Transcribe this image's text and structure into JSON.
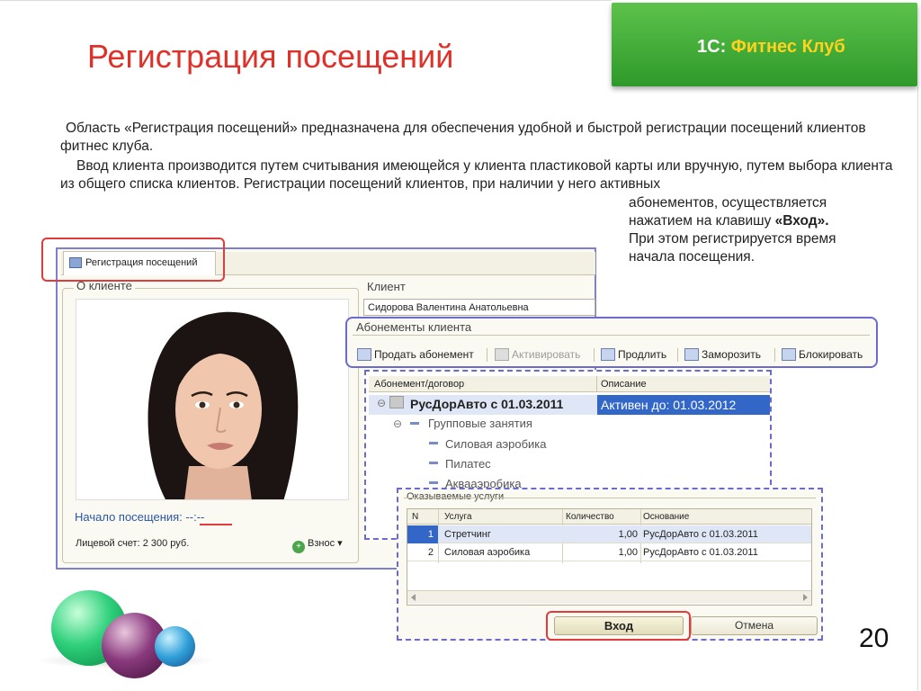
{
  "slide": {
    "title": "Регистрация посещений",
    "brand_prefix": "1С:",
    "brand_name": "Фитнес Клуб",
    "page_number": "20",
    "paragraph1": "Область «Регистрация посещений» предназначена для обеспечения удобной и быстрой регистрации посещений клиентов фитнес клуба.",
    "paragraph2": "Ввод клиента производится путем считывания имеющейся у клиента пластиковой карты или вручную, путем выбора клиента из общего списка клиентов. Регистрации посещений клиентов, при наличии у него активных",
    "paragraph3_a": "абонементов, осуществляется нажатием на клавишу ",
    "paragraph3_key": "«Вход».",
    "paragraph3_b": "При этом регистрируется время начала посещения."
  },
  "app": {
    "tab_label": "Регистрация посещений",
    "about_client_label": "О клиенте",
    "client_label": "Клиент",
    "client_value": "Сидорова Валентина Анатольевна",
    "visit_start_label": "Начало посещения:",
    "visit_start_value": "--:--",
    "balance": "Лицевой счет: 2 300 руб.",
    "vznos_button": "Взнос"
  },
  "subscriptions": {
    "label": "Абонементы клиента",
    "toolbar": [
      {
        "label": "Продать абонемент",
        "enabled": true,
        "icon": "sell-icon"
      },
      {
        "label": "Активировать",
        "enabled": false,
        "icon": "activate-icon"
      },
      {
        "label": "Продлить",
        "enabled": true,
        "icon": "extend-icon"
      },
      {
        "label": "Заморозить",
        "enabled": true,
        "icon": "freeze-icon"
      },
      {
        "label": "Блокировать",
        "enabled": true,
        "icon": "block-icon"
      }
    ],
    "columns": [
      "Абонемент/договор",
      "Описание"
    ],
    "root": "РусДорАвто с 01.03.2011",
    "root_desc": "Активен до: 01.03.2012",
    "group": "Групповые занятия",
    "items": [
      "Силовая аэробика",
      "Пилатес",
      "Аквааэробика"
    ]
  },
  "services": {
    "label": "Оказываемые услуги",
    "columns": [
      "N",
      "Услуга",
      "Количество",
      "Основание"
    ],
    "rows": [
      {
        "n": "1",
        "service": "Стретчинг",
        "qty": "1,00",
        "basis": "РусДорАвто с 01.03.2011"
      },
      {
        "n": "2",
        "service": "Силовая аэробика",
        "qty": "1,00",
        "basis": "РусДорАвто с 01.03.2011"
      }
    ],
    "enter_button": "Вход",
    "cancel_button": "Отмена"
  },
  "colors": {
    "title_red": "#e0302a",
    "brand_green": "#3aa932",
    "brand_yellow": "#ffd21e",
    "highlight_blue": "#3266c7",
    "frame_purple": "#6a6ad0"
  }
}
